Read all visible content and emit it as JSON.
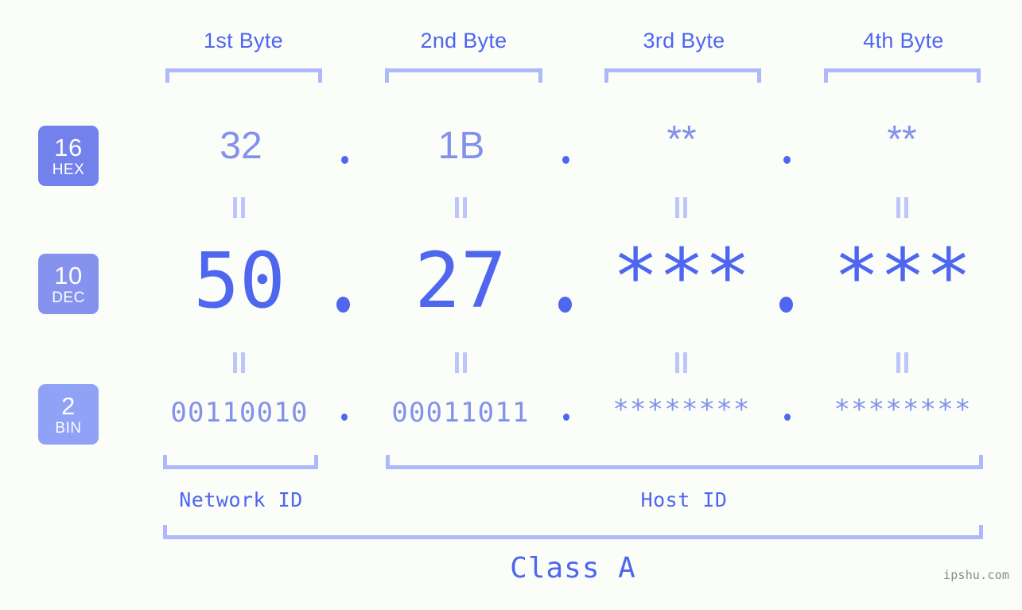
{
  "diagram": {
    "background_color": "#fafdf8",
    "accent_color": "#4f66ef",
    "muted_accent_color": "#8391ec",
    "rail_color": "#aeb9fb"
  },
  "byte_headers": [
    {
      "label": "1st Byte"
    },
    {
      "label": "2nd Byte"
    },
    {
      "label": "3rd Byte"
    },
    {
      "label": "4th Byte"
    }
  ],
  "rows": [
    {
      "badge_number": "16",
      "badge_name": "HEX",
      "badge_color": "#7381ec",
      "values": [
        "32",
        "1B",
        "**",
        "**"
      ],
      "separator": "."
    },
    {
      "badge_number": "10",
      "badge_name": "DEC",
      "badge_color": "#8593ef",
      "values": [
        "50",
        "27",
        "***",
        "***"
      ],
      "separator": "."
    },
    {
      "badge_number": "2",
      "badge_name": "BIN",
      "badge_color": "#8fa2f6",
      "values": [
        "00110010",
        "00011011",
        "********",
        "********"
      ],
      "separator": "."
    }
  ],
  "equals_marks": {
    "symbol": "||",
    "count": 8
  },
  "id_sections": [
    {
      "label": "Network ID"
    },
    {
      "label": "Host ID"
    }
  ],
  "class_section": {
    "label": "Class A"
  },
  "watermark": {
    "text": "ipshu.com"
  }
}
